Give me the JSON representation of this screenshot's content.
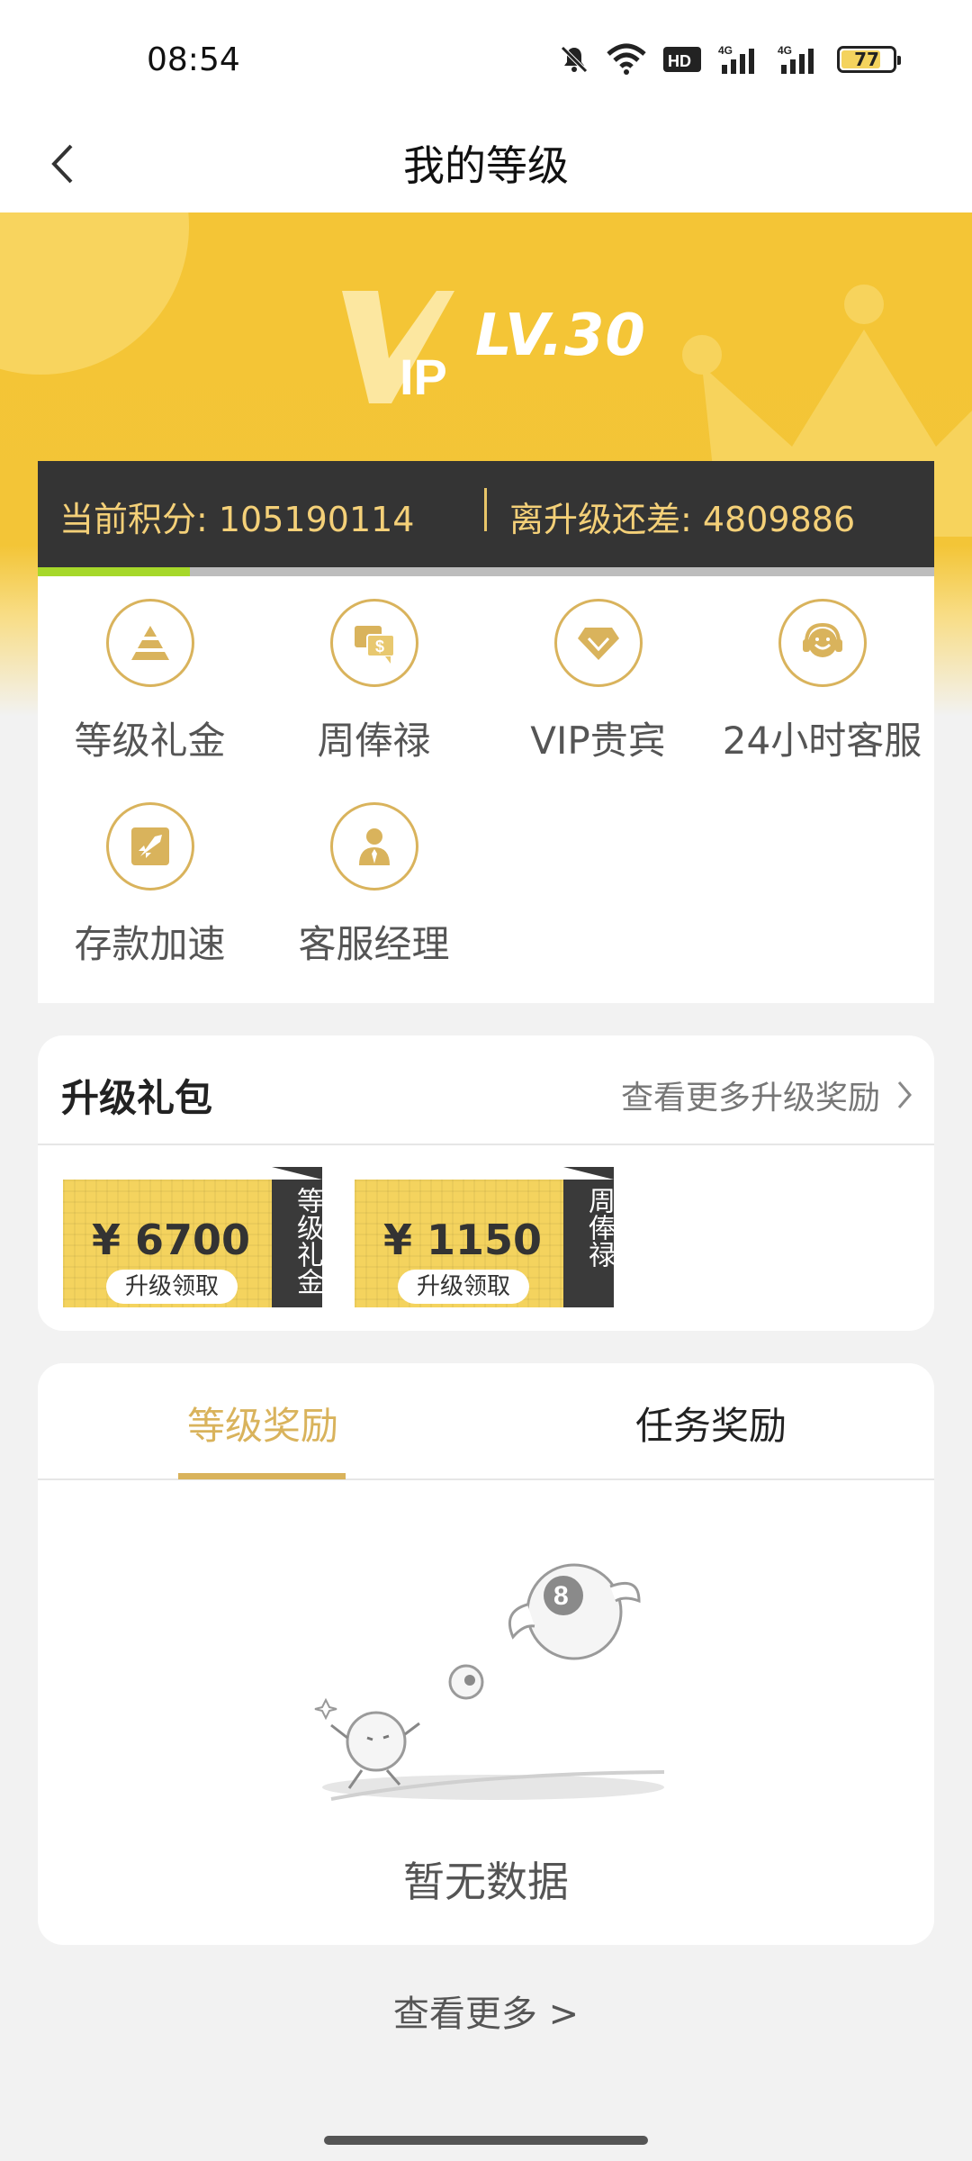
{
  "status_bar": {
    "time": "08:54",
    "icons": [
      "mute-bell-icon",
      "wifi-icon",
      "hd-icon",
      "signal-4g-icon",
      "signal-4g-icon"
    ],
    "battery": "77"
  },
  "nav": {
    "title": "我的等级",
    "back_icon": "chevron-left-icon"
  },
  "vip": {
    "level": "LV.30",
    "current_points": "当前积分: 105190114",
    "points_to_upgrade": "离升级还差: 4809886",
    "progress": 0.17
  },
  "privileges": [
    {
      "label": "等级礼金",
      "icon": "pyramid-icon"
    },
    {
      "label": "周俸禄",
      "icon": "money-chat-icon"
    },
    {
      "label": "VIP贵宾",
      "icon": "diamond-icon"
    },
    {
      "label": "24小时客服",
      "icon": "headset-agent-icon"
    },
    {
      "label": "存款加速",
      "icon": "rocket-icon"
    },
    {
      "label": "客服经理",
      "icon": "manager-icon"
    }
  ],
  "upgrade_package": {
    "title": "升级礼包",
    "more_label": "查看更多升级奖励",
    "coupons": [
      {
        "amount": "¥ 6700",
        "button": "升级领取",
        "tag": "等级礼金"
      },
      {
        "amount": "¥ 1150",
        "button": "升级领取",
        "tag": "周俸禄"
      }
    ]
  },
  "rewards": {
    "tabs": [
      "等级奖励",
      "任务奖励"
    ],
    "active_tab": 0,
    "empty_text": "暂无数据"
  },
  "footer": {
    "see_more": "查看更多 >"
  },
  "colors": {
    "accent_gold": "#d9b35c",
    "hero_yellow": "#f4c536",
    "dark_bar": "#343434",
    "points_text": "#f4d078",
    "progress_green": "#a6d82a"
  }
}
